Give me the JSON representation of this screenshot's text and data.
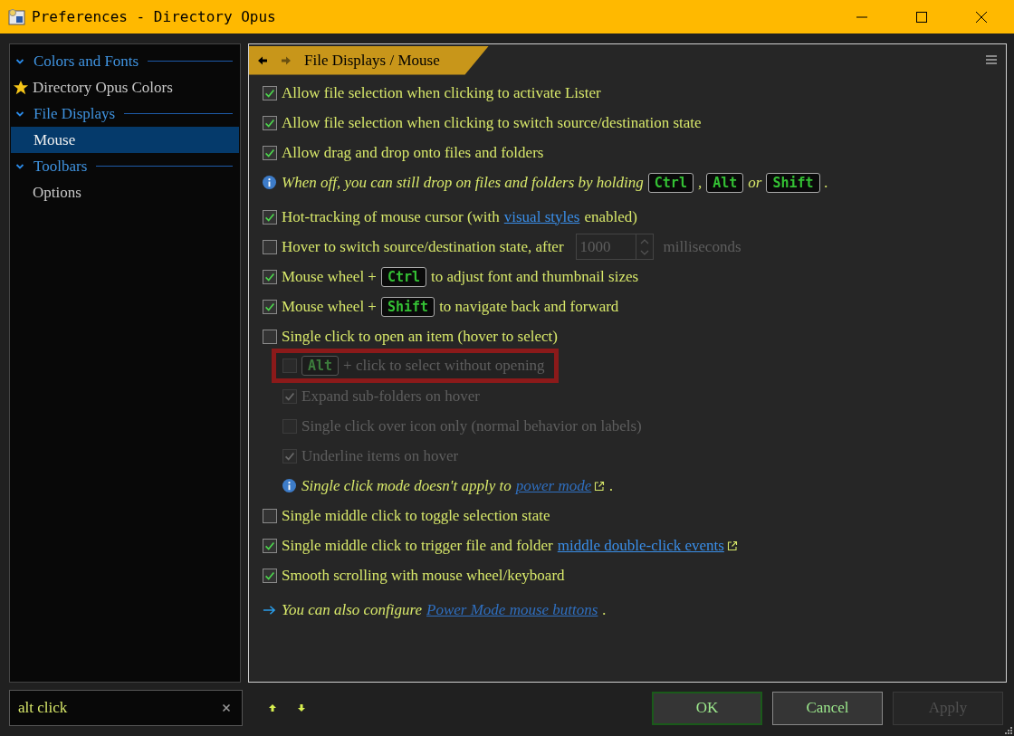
{
  "window": {
    "title": "Preferences - Directory Opus"
  },
  "sidebar": {
    "items": [
      {
        "label": "Colors and Fonts",
        "expanded": true,
        "children": [
          {
            "label": "Directory Opus Colors",
            "kind": "favorite",
            "selected": false
          }
        ]
      },
      {
        "label": "File Displays",
        "expanded": true,
        "children": [
          {
            "label": "Mouse",
            "kind": "page",
            "selected": true
          }
        ]
      },
      {
        "label": "Toolbars",
        "expanded": true,
        "children": [
          {
            "label": "Options",
            "kind": "page",
            "selected": false
          }
        ]
      }
    ]
  },
  "breadcrumb": "File Displays / Mouse",
  "options": [
    {
      "kind": "checkbox",
      "checked": true,
      "disabled": false,
      "parts": [
        {
          "kind": "text",
          "text": "Allow file selection when clicking to activate Lister"
        }
      ]
    },
    {
      "kind": "checkbox",
      "checked": true,
      "disabled": false,
      "parts": [
        {
          "kind": "text",
          "text": "Allow file selection when clicking to switch source/destination state"
        }
      ]
    },
    {
      "kind": "checkbox",
      "checked": true,
      "disabled": false,
      "parts": [
        {
          "kind": "text",
          "text": "Allow drag and drop onto files and folders"
        }
      ]
    },
    {
      "kind": "info",
      "parts": [
        {
          "kind": "text",
          "text": "When off, you can still drop on files and folders by holding"
        },
        {
          "kind": "key",
          "text": "Ctrl"
        },
        {
          "kind": "text",
          "text": ","
        },
        {
          "kind": "key",
          "text": "Alt"
        },
        {
          "kind": "text",
          "text": "or"
        },
        {
          "kind": "key",
          "text": "Shift"
        },
        {
          "kind": "text",
          "text": "."
        }
      ]
    },
    {
      "kind": "spacer"
    },
    {
      "kind": "checkbox",
      "checked": true,
      "disabled": false,
      "parts": [
        {
          "kind": "text",
          "text": "Hot-tracking of mouse cursor (with"
        },
        {
          "kind": "link",
          "text": "visual styles",
          "external": false
        },
        {
          "kind": "text",
          "text": "enabled)"
        }
      ]
    },
    {
      "kind": "checkbox",
      "checked": false,
      "disabled": false,
      "parts": [
        {
          "kind": "text",
          "text": "Hover to switch source/destination state, after"
        },
        {
          "kind": "spin",
          "value": "1000",
          "disabled": true
        },
        {
          "kind": "dim",
          "text": "milliseconds"
        }
      ]
    },
    {
      "kind": "checkbox",
      "checked": true,
      "disabled": false,
      "parts": [
        {
          "kind": "text",
          "text": "Mouse wheel +"
        },
        {
          "kind": "key",
          "text": "Ctrl"
        },
        {
          "kind": "text",
          "text": "to adjust font and thumbnail sizes"
        }
      ]
    },
    {
      "kind": "checkbox",
      "checked": true,
      "disabled": false,
      "parts": [
        {
          "kind": "text",
          "text": "Mouse wheel +"
        },
        {
          "kind": "key",
          "text": "Shift"
        },
        {
          "kind": "text",
          "text": "to navigate back and forward"
        }
      ]
    },
    {
      "kind": "checkbox",
      "checked": false,
      "disabled": false,
      "parts": [
        {
          "kind": "text",
          "text": "Single click to open an item (hover to select)"
        }
      ],
      "children": [
        {
          "kind": "checkbox",
          "checked": false,
          "disabled": true,
          "highlighted": true,
          "parts": [
            {
              "kind": "key",
              "text": "Alt"
            },
            {
              "kind": "text",
              "text": "+ click to select without opening"
            }
          ]
        },
        {
          "kind": "checkbox",
          "checked": true,
          "disabled": true,
          "parts": [
            {
              "kind": "text",
              "text": "Expand sub-folders on hover"
            }
          ]
        },
        {
          "kind": "checkbox",
          "checked": false,
          "disabled": true,
          "parts": [
            {
              "kind": "text",
              "text": "Single click over icon only (normal behavior on labels)"
            }
          ]
        },
        {
          "kind": "checkbox",
          "checked": true,
          "disabled": true,
          "parts": [
            {
              "kind": "text",
              "text": "Underline items on hover"
            }
          ]
        },
        {
          "kind": "info",
          "parts": [
            {
              "kind": "text",
              "text": "Single click mode doesn't apply to"
            },
            {
              "kind": "link",
              "text": "power mode",
              "external": true
            },
            {
              "kind": "text",
              "text": "."
            }
          ]
        }
      ]
    },
    {
      "kind": "checkbox",
      "checked": false,
      "disabled": false,
      "parts": [
        {
          "kind": "text",
          "text": "Single middle click to toggle selection state"
        }
      ]
    },
    {
      "kind": "checkbox",
      "checked": true,
      "disabled": false,
      "parts": [
        {
          "kind": "text",
          "text": "Single middle click to trigger file and folder"
        },
        {
          "kind": "link",
          "text": "middle double-click events",
          "external": true
        }
      ]
    },
    {
      "kind": "checkbox",
      "checked": true,
      "disabled": false,
      "parts": [
        {
          "kind": "text",
          "text": "Smooth scrolling with mouse wheel/keyboard"
        }
      ]
    },
    {
      "kind": "spacer"
    },
    {
      "kind": "note",
      "parts": [
        {
          "kind": "text",
          "text": "You can also configure"
        },
        {
          "kind": "link",
          "text": "Power Mode mouse buttons",
          "external": false
        },
        {
          "kind": "text",
          "text": "."
        }
      ]
    }
  ],
  "search": {
    "value": "alt click"
  },
  "buttons": [
    {
      "label": "OK",
      "kind": "default",
      "disabled": false
    },
    {
      "label": "Cancel",
      "kind": "normal",
      "disabled": false
    },
    {
      "label": "Apply",
      "kind": "normal",
      "disabled": true
    }
  ]
}
